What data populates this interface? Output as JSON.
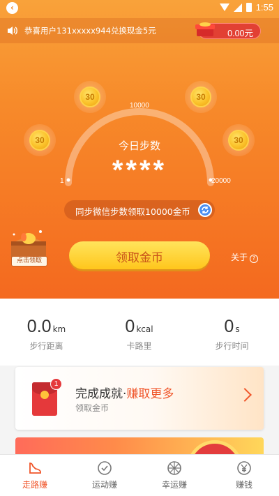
{
  "status_bar": {
    "time": "1:55"
  },
  "notice": {
    "text": "恭喜用户131xxxxx944兑换现金5元"
  },
  "wallet": {
    "amount": "0.00元"
  },
  "coins": [
    "30",
    "30",
    "30",
    "30"
  ],
  "gauge": {
    "label_mid": "10000",
    "label_min": "1",
    "label_max": "20000",
    "title": "今日步数",
    "steps": "****"
  },
  "sync": {
    "text": "同步微信步数领取10000金币"
  },
  "chest": {
    "label": "点击领取"
  },
  "claim_button": {
    "label": "领取金币"
  },
  "about": {
    "label": "关于"
  },
  "stats": [
    {
      "value": "0.0",
      "unit": "km",
      "label": "步行距离"
    },
    {
      "value": "0",
      "unit": "kcal",
      "label": "卡路里"
    },
    {
      "value": "0",
      "unit": "s",
      "label": "步行时间"
    }
  ],
  "achievement": {
    "badge": "1",
    "title_plain": "完成成就·",
    "title_highlight": "赚取更多",
    "subtitle": "领取金币"
  },
  "tabs": [
    {
      "label": "走路赚",
      "icon": "shoe-icon",
      "active": true
    },
    {
      "label": "运动赚",
      "icon": "check-circle-icon",
      "active": false
    },
    {
      "label": "幸运赚",
      "icon": "lucky-wheel-icon",
      "active": false
    },
    {
      "label": "赚钱",
      "icon": "yen-icon",
      "active": false
    }
  ],
  "colors": {
    "accent": "#f0552a",
    "hero_top": "#f9a23a",
    "hero_bottom": "#f4691f",
    "button": "#ffc61c"
  }
}
